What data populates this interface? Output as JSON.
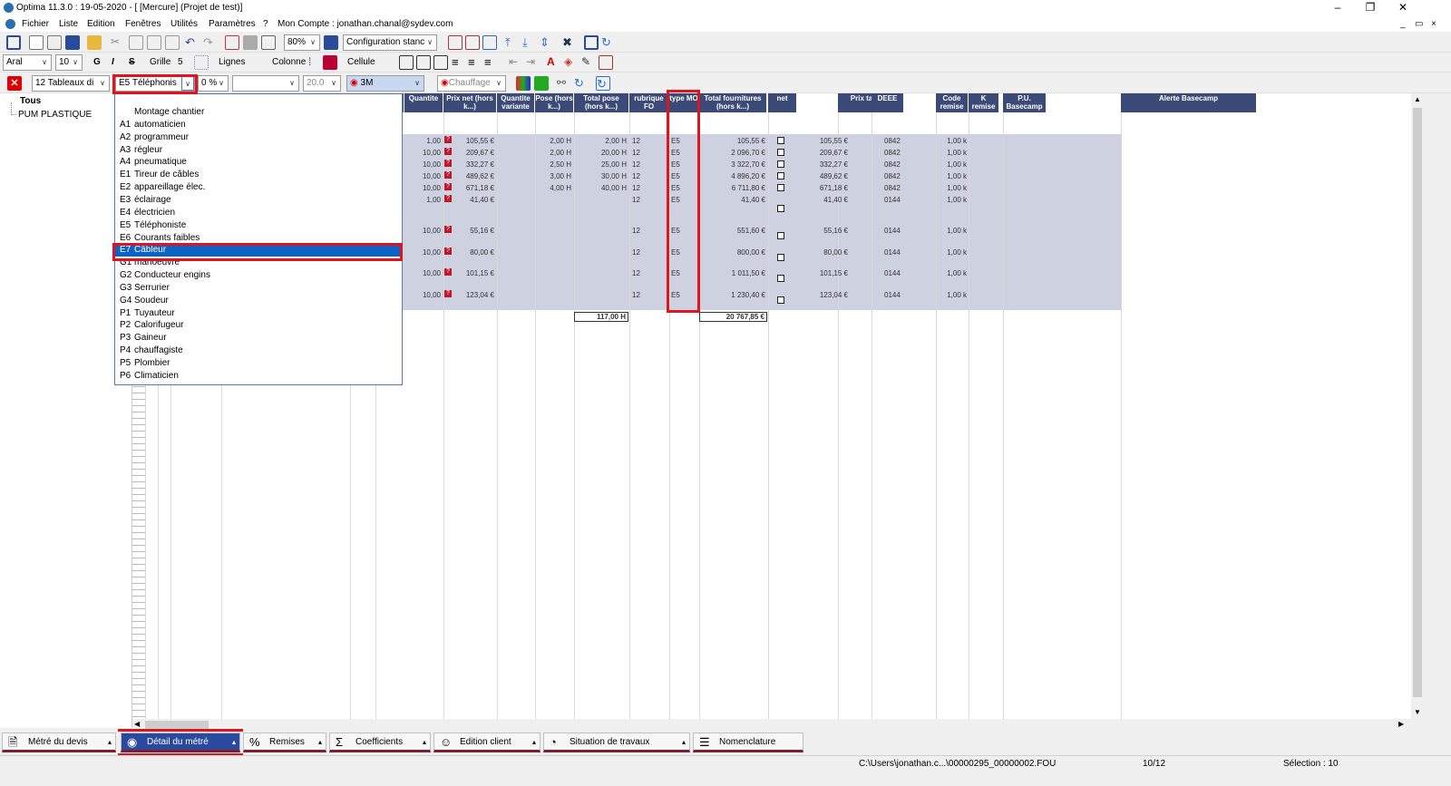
{
  "window": {
    "title": "Optima 11.3.0 : 19-05-2020 - [ [Mercure] (Projet de test)]"
  },
  "menu": [
    "Fichier",
    "Liste",
    "Edition",
    "Fenêtres",
    "Utilités",
    "Paramètres",
    "?",
    "Mon Compte : jonathan.chanal@sydev.com"
  ],
  "toolbar1": {
    "zoom": "80%",
    "config": "Configuration stanc"
  },
  "toolbar2": {
    "font": "Aral",
    "size": "10",
    "bold": "G",
    "italic": "I",
    "strike": "S",
    "grille_label": "Grille",
    "grille_value": "5",
    "lignes_label": "Lignes",
    "colonne_label": "Colonne",
    "cellule_label": "Cellule"
  },
  "toolbar3": {
    "tableaux": "12 Tableaux di",
    "mo": "E5  Téléphonis",
    "num": "0 %",
    "blank": "",
    "val": "20.0",
    "brand": "3M",
    "chauffage": "Chauffage"
  },
  "tree": {
    "items": [
      "Tous",
      "PUM PLASTIQUE"
    ]
  },
  "columns": [
    "Quantite",
    "Prix net (hors k...)",
    "Quantite variante",
    "Pose (hors k...)",
    "Total pose (hors k...)",
    "rubrique FO",
    "type MO",
    "Total fournitures (hors k...)",
    "net",
    "Prix tarif",
    "DEEE",
    "Code remise",
    "K remise",
    "P.U. Basecamp",
    "Alerte Basecamp"
  ],
  "rows": [
    {
      "qte": "1,00",
      "prix": "105,55 €",
      "pose": "2,00 H",
      "tpose": "2,00 H",
      "rub": "12",
      "mo": "E5",
      "tfourn": "105,55 €",
      "tarif": "105,55 €",
      "code": "0842",
      "k": "1,00 k"
    },
    {
      "qte": "10,00",
      "prix": "209,67 €",
      "pose": "2,00 H",
      "tpose": "20,00 H",
      "rub": "12",
      "mo": "E5",
      "tfourn": "2 096,70 €",
      "tarif": "209,67 €",
      "code": "0842",
      "k": "1,00 k"
    },
    {
      "qte": "10,00",
      "prix": "332,27 €",
      "pose": "2,50 H",
      "tpose": "25,00 H",
      "rub": "12",
      "mo": "E5",
      "tfourn": "3 322,70 €",
      "tarif": "332,27 €",
      "code": "0842",
      "k": "1,00 k"
    },
    {
      "qte": "10,00",
      "prix": "489,62 €",
      "pose": "3,00 H",
      "tpose": "30,00 H",
      "rub": "12",
      "mo": "E5",
      "tfourn": "4 896,20 €",
      "tarif": "489,62 €",
      "code": "0842",
      "k": "1,00 k"
    },
    {
      "qte": "10,00",
      "prix": "671,18 €",
      "pose": "4,00 H",
      "tpose": "40,00 H",
      "rub": "12",
      "mo": "E5",
      "tfourn": "6 711,80 €",
      "tarif": "671,18 €",
      "code": "0842",
      "k": "1,00 k"
    },
    {
      "qte": "1,00",
      "prix": "41,40 €",
      "pose": "",
      "tpose": "",
      "rub": "12",
      "mo": "E5",
      "tfourn": "41,40 €",
      "tarif": "41,40 €",
      "code": "0144",
      "k": "1,00 k"
    },
    {
      "qte": "10,00",
      "prix": "55,16 €",
      "pose": "",
      "tpose": "",
      "rub": "12",
      "mo": "E5",
      "tfourn": "551,60 €",
      "tarif": "55,16 €",
      "code": "0144",
      "k": "1,00 k"
    },
    {
      "qte": "10,00",
      "prix": "80,00 €",
      "pose": "",
      "tpose": "",
      "rub": "12",
      "mo": "E5",
      "tfourn": "800,00 €",
      "tarif": "80,00 €",
      "code": "0144",
      "k": "1,00 k"
    },
    {
      "qte": "10,00",
      "prix": "101,15 €",
      "pose": "",
      "tpose": "",
      "rub": "12",
      "mo": "E5",
      "tfourn": "1 011,50 €",
      "tarif": "101,15 €",
      "code": "0144",
      "k": "1,00 k"
    },
    {
      "qte": "10,00",
      "prix": "123,04 €",
      "pose": "",
      "tpose": "",
      "rub": "12",
      "mo": "E5",
      "tfourn": "1 230,40 €",
      "tarif": "123,04 €",
      "code": "0144",
      "k": "1,00 k"
    }
  ],
  "totals": {
    "pose": "117,00 H",
    "fourn": "20 767,85 €"
  },
  "dropdown": {
    "options": [
      {
        "code": "",
        "label": "Montage chantier"
      },
      {
        "code": "A1",
        "label": "automaticien"
      },
      {
        "code": "A2",
        "label": "programmeur"
      },
      {
        "code": "A3",
        "label": "régleur"
      },
      {
        "code": "A4",
        "label": "pneumatique"
      },
      {
        "code": "E1",
        "label": "Tireur de câbles"
      },
      {
        "code": "E2",
        "label": "appareillage élec."
      },
      {
        "code": "E3",
        "label": "éclairage"
      },
      {
        "code": "E4",
        "label": "électricien"
      },
      {
        "code": "E5",
        "label": "Téléphoniste"
      },
      {
        "code": "E6",
        "label": "Courants faibles"
      },
      {
        "code": "E7",
        "label": "Câbleur"
      },
      {
        "code": "G1",
        "label": "manoeuvre"
      },
      {
        "code": "G2",
        "label": "Conducteur engins"
      },
      {
        "code": "G3",
        "label": "Serrurier"
      },
      {
        "code": "G4",
        "label": "Soudeur"
      },
      {
        "code": "P1",
        "label": "Tuyauteur"
      },
      {
        "code": "P2",
        "label": "Calorifugeur"
      },
      {
        "code": "P3",
        "label": "Gaineur"
      },
      {
        "code": "P4",
        "label": "chauffagiste"
      },
      {
        "code": "P5",
        "label": "Plombier"
      },
      {
        "code": "P6",
        "label": "Climaticien"
      }
    ],
    "highlighted": "E7"
  },
  "tabs": [
    "Métré du devis",
    "Détail du métré",
    "Remises",
    "Coefficients",
    "Edition client",
    "Situation de travaux",
    "Nomenclature"
  ],
  "status": {
    "path": "C:\\Users\\jonathan.c...\\00000295_00000002.FOU",
    "page": "10/12",
    "selection": "Sélection : 10"
  }
}
